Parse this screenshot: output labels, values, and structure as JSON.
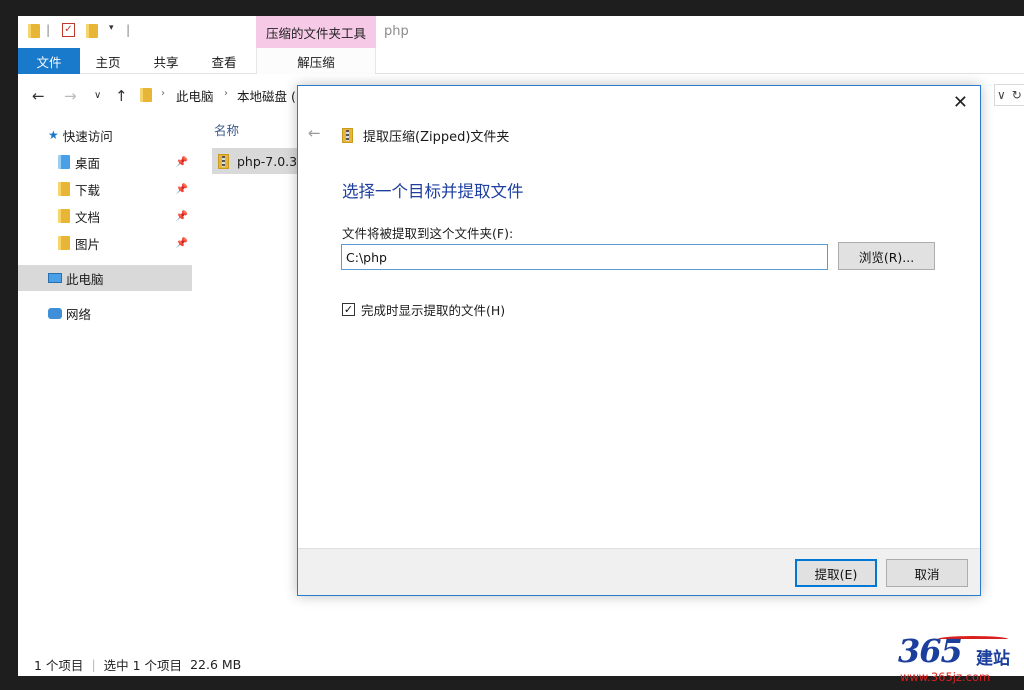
{
  "window": {
    "title": "php",
    "contextual_tab_group": "压缩的文件夹工具"
  },
  "ribbon": {
    "tabs": [
      "文件",
      "主页",
      "共享",
      "查看"
    ],
    "contextual_tab": "解压缩"
  },
  "address_bar": {
    "crumbs": [
      "此电脑",
      "本地磁盘 ("
    ]
  },
  "nav_pane": {
    "quick_access": "快速访问",
    "items": [
      {
        "label": "桌面",
        "icon": "desktop-folder-icon",
        "pinned": true
      },
      {
        "label": "下载",
        "icon": "download-folder-icon",
        "pinned": true
      },
      {
        "label": "文档",
        "icon": "documents-folder-icon",
        "pinned": true
      },
      {
        "label": "图片",
        "icon": "pictures-folder-icon",
        "pinned": true
      }
    ],
    "this_pc": "此电脑",
    "network": "网络"
  },
  "file_list": {
    "column_name": "名称",
    "files": [
      {
        "name": "php-7.0.3"
      }
    ]
  },
  "status_bar": {
    "item_count": "1 个项目",
    "selection": "选中 1 个项目",
    "size": "22.6 MB"
  },
  "dialog": {
    "header": "提取压缩(Zipped)文件夹",
    "heading": "选择一个目标并提取文件",
    "dest_label": "文件将被提取到这个文件夹(F):",
    "dest_value": "C:\\php",
    "browse": "浏览(R)...",
    "show_files_label": "完成时显示提取的文件(H)",
    "show_files_checked": true,
    "extract": "提取(E)",
    "cancel": "取消"
  },
  "watermark": {
    "brand": "365",
    "brand_cn": "建站",
    "url": "www.365jz.com"
  },
  "colors": {
    "file_tab": "#1979ca",
    "contextual": "#f6c9e6",
    "dialog_heading": "#1f3fa0",
    "selection": "#d9d9d9"
  }
}
